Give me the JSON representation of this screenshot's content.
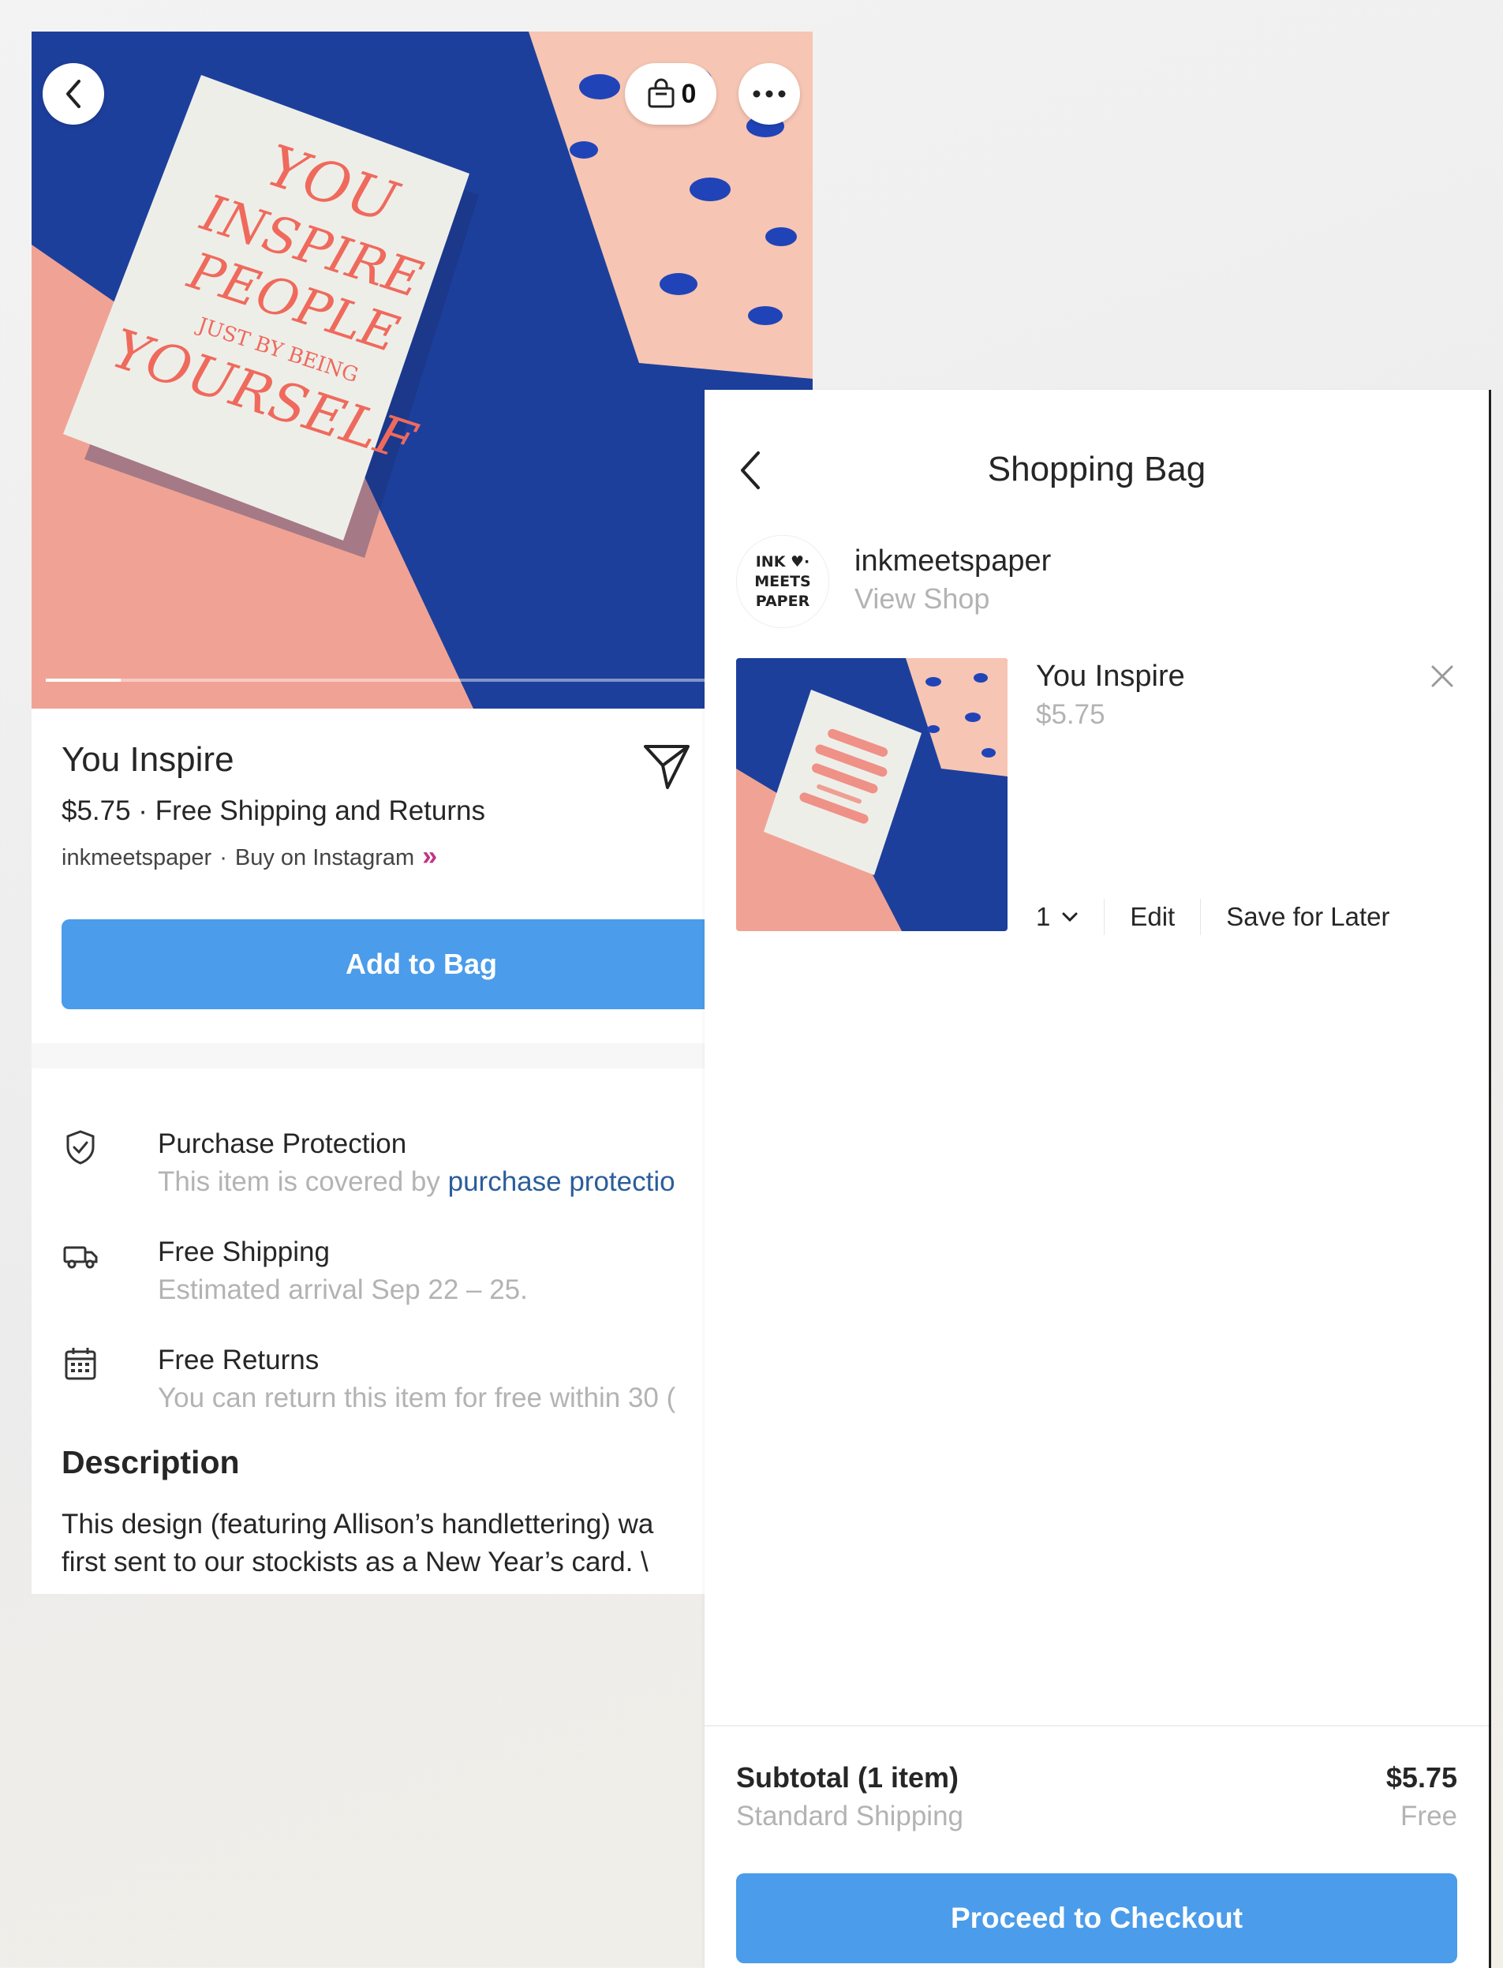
{
  "product": {
    "bag_count": "0",
    "image_progress": 0.1,
    "title": "You Inspire",
    "price_line": "$5.75 · Free Shipping and Returns",
    "seller": "inkmeetspaper",
    "separator": "·",
    "buy_link": "Buy on Instagram",
    "add_to_bag_label": "Add to Bag",
    "card_art_lines": [
      "YOU",
      "INSPIRE",
      "PEOPLE",
      "JUST BY BEING",
      "YOURSELF"
    ],
    "features": [
      {
        "title": "Purchase Protection",
        "subtitle": "This item is covered by ",
        "link": "purchase protectio",
        "icon": "shield-check-icon"
      },
      {
        "title": "Free Shipping",
        "subtitle": "Estimated arrival Sep 22 – 25.",
        "icon": "truck-icon"
      },
      {
        "title": "Free Returns",
        "subtitle": "You can return this item for free within 30 (",
        "icon": "calendar-icon"
      }
    ],
    "description_heading": "Description",
    "description_lines": [
      "This design (featuring Allison’s handlettering) wa",
      "first sent to our stockists as a New Year’s card. \\"
    ]
  },
  "bag": {
    "title": "Shopping Bag",
    "shop_logo_lines": [
      "INK ♥·",
      "MEETS",
      "PAPER"
    ],
    "shop_name": "inkmeetspaper",
    "view_shop": "View Shop",
    "item": {
      "name": "You Inspire",
      "price": "$5.75",
      "quantity": "1",
      "edit_label": "Edit",
      "save_label": "Save for Later"
    },
    "subtotal_label": "Subtotal (1 item)",
    "subtotal_value": "$5.75",
    "shipping_label": "Standard Shipping",
    "shipping_value": "Free",
    "checkout_label": "Proceed to Checkout"
  },
  "colors": {
    "accent_blue": "#4b9cea",
    "link_blue": "#2a5d9b",
    "instagram_magenta": "#c13584",
    "hero_pink": "#f0a394",
    "hero_navy": "#1d3f9c"
  }
}
